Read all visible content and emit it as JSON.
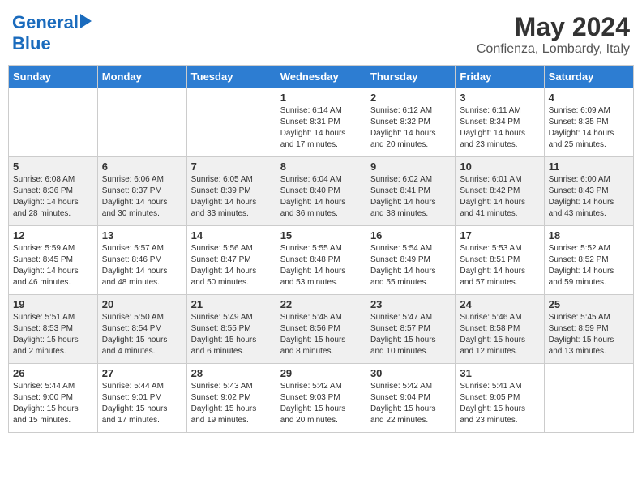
{
  "logo": {
    "text_general": "General",
    "text_blue": "Blue"
  },
  "title": "May 2024",
  "location": "Confienza, Lombardy, Italy",
  "days_of_week": [
    "Sunday",
    "Monday",
    "Tuesday",
    "Wednesday",
    "Thursday",
    "Friday",
    "Saturday"
  ],
  "weeks": [
    [
      {
        "day": "",
        "info": ""
      },
      {
        "day": "",
        "info": ""
      },
      {
        "day": "",
        "info": ""
      },
      {
        "day": "1",
        "info": "Sunrise: 6:14 AM\nSunset: 8:31 PM\nDaylight: 14 hours\nand 17 minutes."
      },
      {
        "day": "2",
        "info": "Sunrise: 6:12 AM\nSunset: 8:32 PM\nDaylight: 14 hours\nand 20 minutes."
      },
      {
        "day": "3",
        "info": "Sunrise: 6:11 AM\nSunset: 8:34 PM\nDaylight: 14 hours\nand 23 minutes."
      },
      {
        "day": "4",
        "info": "Sunrise: 6:09 AM\nSunset: 8:35 PM\nDaylight: 14 hours\nand 25 minutes."
      }
    ],
    [
      {
        "day": "5",
        "info": "Sunrise: 6:08 AM\nSunset: 8:36 PM\nDaylight: 14 hours\nand 28 minutes."
      },
      {
        "day": "6",
        "info": "Sunrise: 6:06 AM\nSunset: 8:37 PM\nDaylight: 14 hours\nand 30 minutes."
      },
      {
        "day": "7",
        "info": "Sunrise: 6:05 AM\nSunset: 8:39 PM\nDaylight: 14 hours\nand 33 minutes."
      },
      {
        "day": "8",
        "info": "Sunrise: 6:04 AM\nSunset: 8:40 PM\nDaylight: 14 hours\nand 36 minutes."
      },
      {
        "day": "9",
        "info": "Sunrise: 6:02 AM\nSunset: 8:41 PM\nDaylight: 14 hours\nand 38 minutes."
      },
      {
        "day": "10",
        "info": "Sunrise: 6:01 AM\nSunset: 8:42 PM\nDaylight: 14 hours\nand 41 minutes."
      },
      {
        "day": "11",
        "info": "Sunrise: 6:00 AM\nSunset: 8:43 PM\nDaylight: 14 hours\nand 43 minutes."
      }
    ],
    [
      {
        "day": "12",
        "info": "Sunrise: 5:59 AM\nSunset: 8:45 PM\nDaylight: 14 hours\nand 46 minutes."
      },
      {
        "day": "13",
        "info": "Sunrise: 5:57 AM\nSunset: 8:46 PM\nDaylight: 14 hours\nand 48 minutes."
      },
      {
        "day": "14",
        "info": "Sunrise: 5:56 AM\nSunset: 8:47 PM\nDaylight: 14 hours\nand 50 minutes."
      },
      {
        "day": "15",
        "info": "Sunrise: 5:55 AM\nSunset: 8:48 PM\nDaylight: 14 hours\nand 53 minutes."
      },
      {
        "day": "16",
        "info": "Sunrise: 5:54 AM\nSunset: 8:49 PM\nDaylight: 14 hours\nand 55 minutes."
      },
      {
        "day": "17",
        "info": "Sunrise: 5:53 AM\nSunset: 8:51 PM\nDaylight: 14 hours\nand 57 minutes."
      },
      {
        "day": "18",
        "info": "Sunrise: 5:52 AM\nSunset: 8:52 PM\nDaylight: 14 hours\nand 59 minutes."
      }
    ],
    [
      {
        "day": "19",
        "info": "Sunrise: 5:51 AM\nSunset: 8:53 PM\nDaylight: 15 hours\nand 2 minutes."
      },
      {
        "day": "20",
        "info": "Sunrise: 5:50 AM\nSunset: 8:54 PM\nDaylight: 15 hours\nand 4 minutes."
      },
      {
        "day": "21",
        "info": "Sunrise: 5:49 AM\nSunset: 8:55 PM\nDaylight: 15 hours\nand 6 minutes."
      },
      {
        "day": "22",
        "info": "Sunrise: 5:48 AM\nSunset: 8:56 PM\nDaylight: 15 hours\nand 8 minutes."
      },
      {
        "day": "23",
        "info": "Sunrise: 5:47 AM\nSunset: 8:57 PM\nDaylight: 15 hours\nand 10 minutes."
      },
      {
        "day": "24",
        "info": "Sunrise: 5:46 AM\nSunset: 8:58 PM\nDaylight: 15 hours\nand 12 minutes."
      },
      {
        "day": "25",
        "info": "Sunrise: 5:45 AM\nSunset: 8:59 PM\nDaylight: 15 hours\nand 13 minutes."
      }
    ],
    [
      {
        "day": "26",
        "info": "Sunrise: 5:44 AM\nSunset: 9:00 PM\nDaylight: 15 hours\nand 15 minutes."
      },
      {
        "day": "27",
        "info": "Sunrise: 5:44 AM\nSunset: 9:01 PM\nDaylight: 15 hours\nand 17 minutes."
      },
      {
        "day": "28",
        "info": "Sunrise: 5:43 AM\nSunset: 9:02 PM\nDaylight: 15 hours\nand 19 minutes."
      },
      {
        "day": "29",
        "info": "Sunrise: 5:42 AM\nSunset: 9:03 PM\nDaylight: 15 hours\nand 20 minutes."
      },
      {
        "day": "30",
        "info": "Sunrise: 5:42 AM\nSunset: 9:04 PM\nDaylight: 15 hours\nand 22 minutes."
      },
      {
        "day": "31",
        "info": "Sunrise: 5:41 AM\nSunset: 9:05 PM\nDaylight: 15 hours\nand 23 minutes."
      },
      {
        "day": "",
        "info": ""
      }
    ]
  ]
}
